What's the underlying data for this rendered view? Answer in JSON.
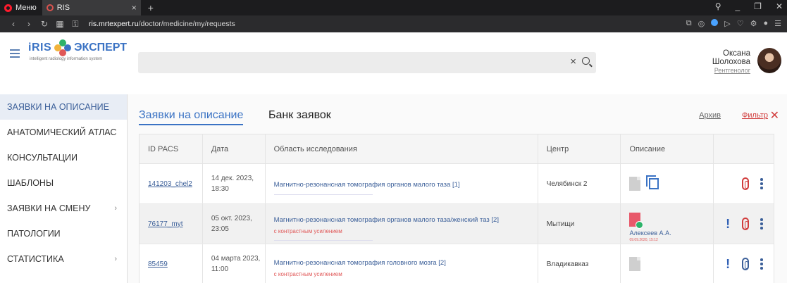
{
  "browser": {
    "menu_label": "Меню",
    "tab_title": "RIS",
    "url_host": "ris.mrtexpert.ru",
    "url_path": "/doctor/medicine/my/requests"
  },
  "brand": {
    "name_left": "iRIS",
    "name_right": "ЭКСПЕРТ",
    "subtitle": "intelligent radiology information system"
  },
  "search": {
    "value": "",
    "clear_icon": "×"
  },
  "user": {
    "first_name": "Оксана",
    "last_name": "Шолохова",
    "role": "Рентгенолог"
  },
  "sidebar": {
    "items": [
      {
        "label": "Заявки на описание",
        "active": true,
        "chevron": false
      },
      {
        "label": "Анатомический атлас",
        "active": false,
        "chevron": false
      },
      {
        "label": "Консультации",
        "active": false,
        "chevron": false
      },
      {
        "label": "Шаблоны",
        "active": false,
        "chevron": false
      },
      {
        "label": "Заявки на смену",
        "active": false,
        "chevron": true
      },
      {
        "label": "Патологии",
        "active": false,
        "chevron": false
      },
      {
        "label": "Статистика",
        "active": false,
        "chevron": true
      }
    ]
  },
  "main": {
    "tab_active": "Заявки на описание",
    "tab_other": "Банк заявок",
    "archive_label": "Архив",
    "filter_label": "Фильтр"
  },
  "table": {
    "headers": [
      "ID PACS",
      "Дата",
      "Область исследования",
      "Центр",
      "Описание",
      ""
    ],
    "rows": [
      {
        "id": "141203_chel2",
        "date1": "14 дек. 2023,",
        "date2": "18:30",
        "area": "Магнитно-резонансная томография органов малого таза [1]",
        "area_sub": "",
        "center": "Челябинск 2",
        "doctor": "",
        "doctor_date": ""
      },
      {
        "id": "76177_myt",
        "date1": "05 окт. 2023,",
        "date2": "23:05",
        "area": "Магнитно-резонансная томография органов малого таза/женский таз [2]",
        "area_sub": "с контрастным усилением",
        "center": "Мытищи",
        "doctor": "Алексеев А.А.",
        "doctor_date": "09.09.2020, 15:12"
      },
      {
        "id": "85459",
        "date1": "04 марта 2023,",
        "date2": "11:00",
        "area": "Магнитно-резонансная томография головного мозга [2]",
        "area_sub": "с контрастным усилением",
        "center": "Владикавказ",
        "doctor": "",
        "doctor_date": ""
      }
    ]
  },
  "colors": {
    "accent": "#3b73c4",
    "danger": "#d13c3c",
    "sidebar_active_bg": "#e8edf5"
  }
}
